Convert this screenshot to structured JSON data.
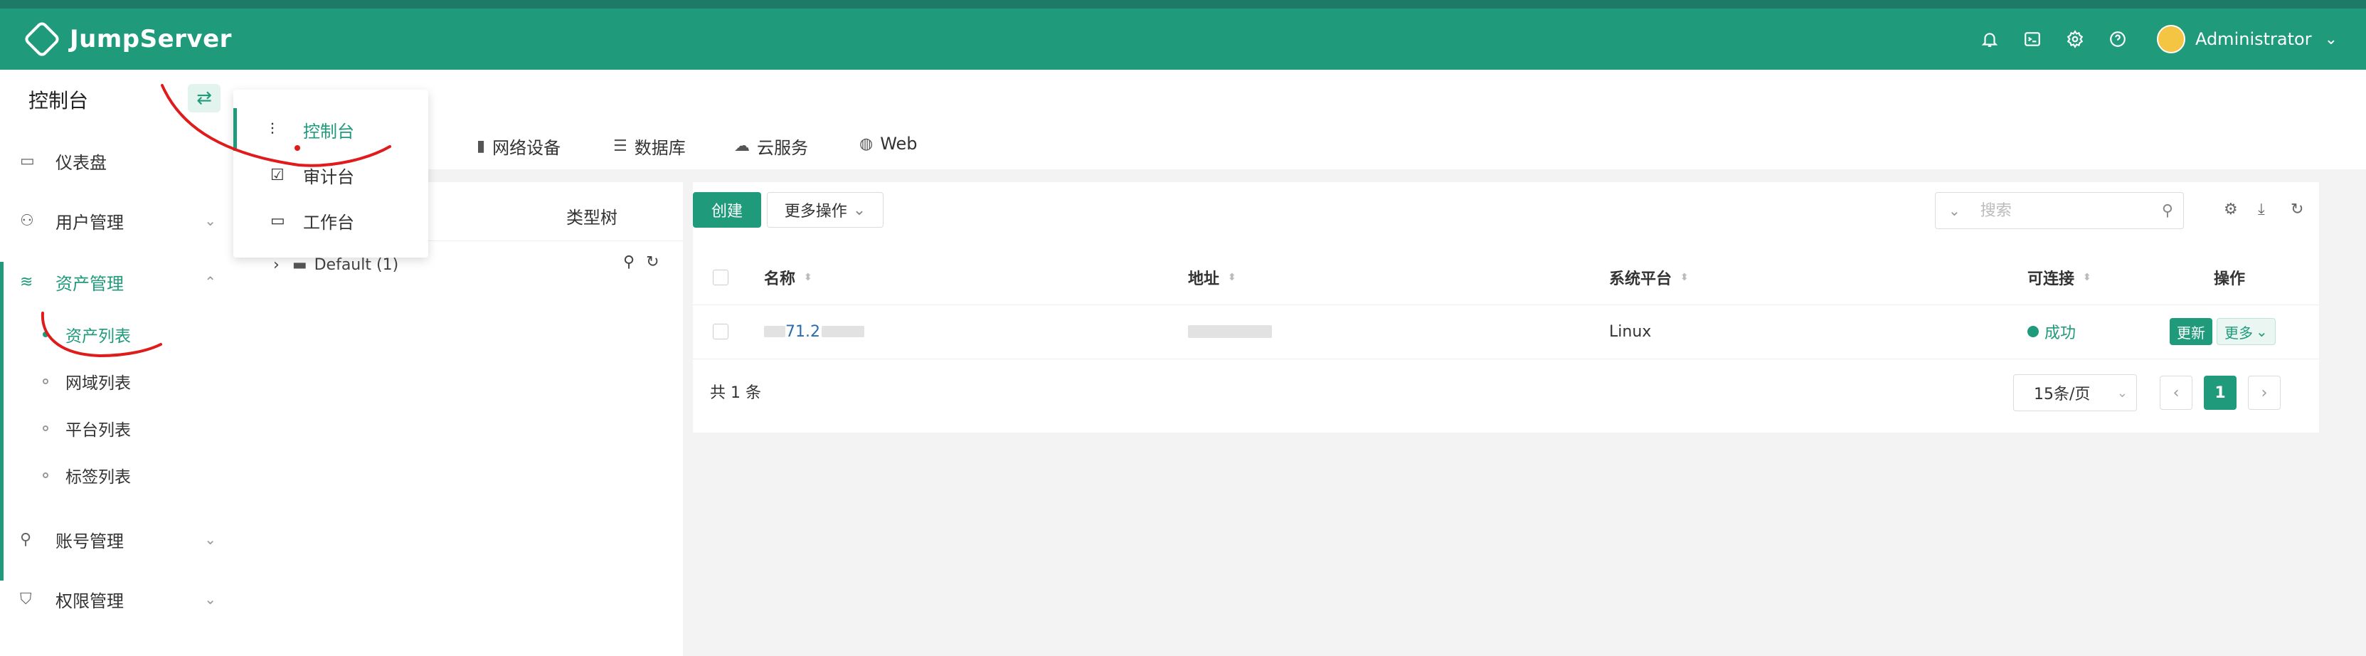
{
  "header": {
    "brand": "JumpServer",
    "user": "Administrator",
    "icons": [
      "bell-icon",
      "terminal-icon",
      "gear-icon",
      "help-icon"
    ]
  },
  "sidebar": {
    "title": "控制台",
    "items": [
      {
        "label": "仪表盘",
        "icon": "dashboard-icon"
      },
      {
        "label": "用户管理",
        "icon": "users-icon"
      },
      {
        "label": "资产管理",
        "icon": "stack-icon"
      },
      {
        "label": "账号管理",
        "icon": "account-icon"
      },
      {
        "label": "权限管理",
        "icon": "shield-icon"
      }
    ],
    "asset_sub": [
      "资产列表",
      "网域列表",
      "平台列表",
      "标签列表"
    ]
  },
  "dropdown": {
    "items": [
      {
        "label": "控制台",
        "icon": "sliders-icon"
      },
      {
        "label": "审计台",
        "icon": "checkbox-icon"
      },
      {
        "label": "工作台",
        "icon": "monitor-icon"
      }
    ]
  },
  "tabs": [
    {
      "label": "网络设备",
      "icon": "network-icon"
    },
    {
      "label": "数据库",
      "icon": "database-icon"
    },
    {
      "label": "云服务",
      "icon": "cloud-icon"
    },
    {
      "label": "Web",
      "icon": "globe-icon"
    }
  ],
  "tree": {
    "tab_label": "类型树",
    "node_label": "Default (1)"
  },
  "toolbar": {
    "create_label": "创建",
    "more_actions_label": "更多操作",
    "search_placeholder": "搜索"
  },
  "table": {
    "columns": [
      "名称",
      "地址",
      "系统平台",
      "可连接",
      "操作"
    ],
    "rows": [
      {
        "name": "71.2",
        "address": "",
        "platform": "Linux",
        "status": "成功",
        "action_update": "更新",
        "action_more": "更多"
      }
    ]
  },
  "pagination": {
    "total": "共 1 条",
    "page_size": "15条/页",
    "current_page": "1"
  },
  "colors": {
    "brand": "#1f9a7b",
    "annotation": "#e01b1b"
  }
}
